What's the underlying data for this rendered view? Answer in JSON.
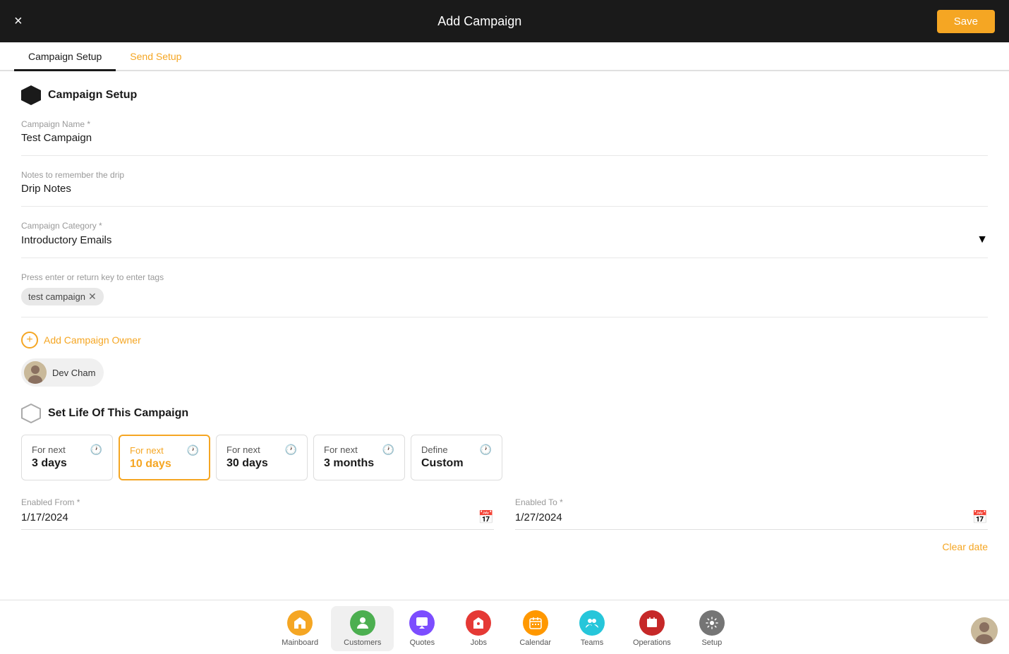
{
  "header": {
    "title": "Add Campaign",
    "close_label": "×",
    "save_label": "Save"
  },
  "tabs": [
    {
      "id": "campaign-setup",
      "label": "Campaign Setup",
      "active": true
    },
    {
      "id": "send-setup",
      "label": "Send Setup",
      "active": false
    }
  ],
  "section": {
    "title": "Campaign Setup",
    "fields": {
      "campaign_name_label": "Campaign Name *",
      "campaign_name_value": "Test Campaign",
      "notes_label": "Notes to remember the drip",
      "notes_value": "Drip Notes",
      "category_label": "Campaign Category *",
      "category_value": "Introductory Emails",
      "tags_label": "Press enter or return key to enter tags",
      "tags": [
        {
          "label": "test campaign"
        }
      ]
    },
    "owner": {
      "add_label": "Add Campaign Owner",
      "name": "Dev Cham"
    },
    "campaign_life": {
      "title": "Set Life Of This Campaign",
      "options": [
        {
          "id": "3days",
          "label": "For next",
          "value": "3 days",
          "selected": false
        },
        {
          "id": "10days",
          "label": "For next",
          "value": "10 days",
          "selected": true
        },
        {
          "id": "30days",
          "label": "For next",
          "value": "30 days",
          "selected": false
        },
        {
          "id": "3months",
          "label": "For next",
          "value": "3 months",
          "selected": false
        },
        {
          "id": "custom",
          "label": "Define",
          "value": "Custom",
          "selected": false
        }
      ]
    },
    "dates": {
      "enabled_from_label": "Enabled From *",
      "enabled_from_value": "1/17/2024",
      "enabled_to_label": "Enabled To *",
      "enabled_to_value": "1/27/2024",
      "clear_label": "Clear date"
    }
  },
  "bottom_nav": {
    "items": [
      {
        "id": "mainboard",
        "label": "Mainboard",
        "icon": "🏠",
        "color": "yellow",
        "active": false
      },
      {
        "id": "customers",
        "label": "Customers",
        "icon": "👤",
        "color": "green",
        "active": true
      },
      {
        "id": "quotes",
        "label": "Quotes",
        "icon": "💬",
        "color": "purple",
        "active": false
      },
      {
        "id": "jobs",
        "label": "Jobs",
        "icon": "🔧",
        "color": "red",
        "active": false
      },
      {
        "id": "calendar",
        "label": "Calendar",
        "icon": "📅",
        "color": "orange",
        "active": false
      },
      {
        "id": "teams",
        "label": "Teams",
        "icon": "👥",
        "color": "teal",
        "active": false
      },
      {
        "id": "operations",
        "label": "Operations",
        "icon": "🏷",
        "color": "dark-red",
        "active": false
      },
      {
        "id": "setup",
        "label": "Setup",
        "icon": "⚙",
        "color": "gray",
        "active": false
      }
    ]
  }
}
